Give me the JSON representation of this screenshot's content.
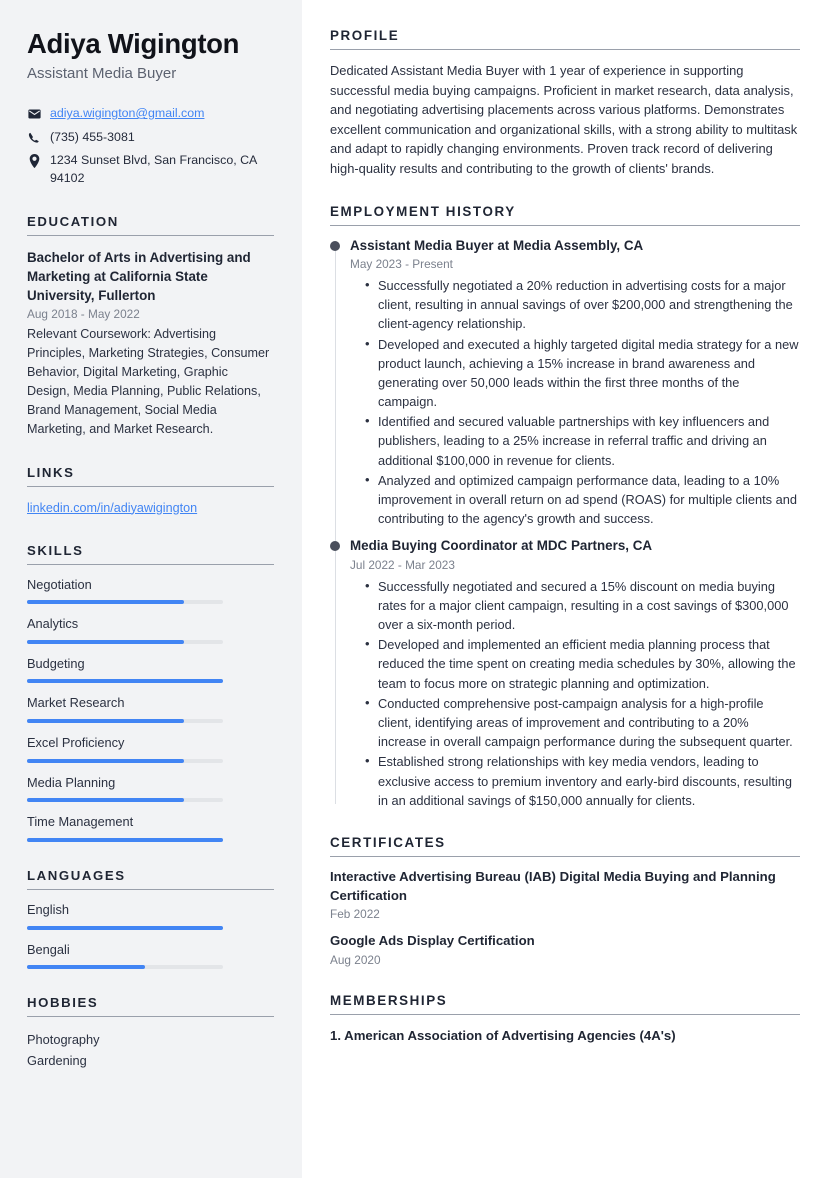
{
  "accent_color": "#4285f4",
  "sidebar_bg": "#f2f3f5",
  "heading_color": "#1f2533",
  "header": {
    "name": "Adiya Wigington",
    "job_title": "Assistant Media Buyer"
  },
  "contact": [
    {
      "icon": "envelope-icon",
      "text": "adiya.wigington@gmail.com",
      "is_link": true
    },
    {
      "icon": "phone-icon",
      "text": "(735) 455-3081",
      "is_link": false
    },
    {
      "icon": "location-pin-icon",
      "text": "1234 Sunset Blvd, San Francisco, CA 94102",
      "is_link": false
    }
  ],
  "education": {
    "heading": "EDUCATION",
    "items": [
      {
        "degree": "Bachelor of Arts in Advertising and Marketing at California State University, Fullerton",
        "date": "Aug 2018 - May 2022",
        "description": "Relevant Coursework: Advertising Principles, Marketing Strategies, Consumer Behavior, Digital Marketing, Graphic Design, Media Planning, Public Relations, Brand Management, Social Media Marketing, and Market Research."
      }
    ]
  },
  "links": {
    "heading": "LINKS",
    "items": [
      {
        "label": "linkedin.com/in/adiyawigington"
      }
    ]
  },
  "skills": {
    "heading": "SKILLS",
    "items": [
      {
        "label": "Negotiation",
        "level": 80
      },
      {
        "label": "Analytics",
        "level": 80
      },
      {
        "label": "Budgeting",
        "level": 100
      },
      {
        "label": "Market Research",
        "level": 80
      },
      {
        "label": "Excel Proficiency",
        "level": 80
      },
      {
        "label": "Media Planning",
        "level": 80
      },
      {
        "label": "Time Management",
        "level": 100
      }
    ]
  },
  "languages": {
    "heading": "LANGUAGES",
    "items": [
      {
        "label": "English",
        "level": 100
      },
      {
        "label": "Bengali",
        "level": 60
      }
    ]
  },
  "hobbies": {
    "heading": "HOBBIES",
    "items": [
      {
        "label": "Photography"
      },
      {
        "label": "Gardening"
      }
    ]
  },
  "profile": {
    "heading": "PROFILE",
    "text": "Dedicated Assistant Media Buyer with 1 year of experience in supporting successful media buying campaigns. Proficient in market research, data analysis, and negotiating advertising placements across various platforms. Demonstrates excellent communication and organizational skills, with a strong ability to multitask and adapt to rapidly changing environments. Proven track record of delivering high-quality results and contributing to the growth of clients' brands."
  },
  "employment": {
    "heading": "EMPLOYMENT HISTORY",
    "jobs": [
      {
        "title": "Assistant Media Buyer at Media Assembly, CA",
        "date": "May 2023 - Present",
        "bullets": [
          "Successfully negotiated a 20% reduction in advertising costs for a major client, resulting in annual savings of over $200,000 and strengthening the client-agency relationship.",
          "Developed and executed a highly targeted digital media strategy for a new product launch, achieving a 15% increase in brand awareness and generating over 50,000 leads within the first three months of the campaign.",
          "Identified and secured valuable partnerships with key influencers and publishers, leading to a 25% increase in referral traffic and driving an additional $100,000 in revenue for clients.",
          "Analyzed and optimized campaign performance data, leading to a 10% improvement in overall return on ad spend (ROAS) for multiple clients and contributing to the agency's growth and success."
        ]
      },
      {
        "title": "Media Buying Coordinator at MDC Partners, CA",
        "date": "Jul 2022 - Mar 2023",
        "bullets": [
          "Successfully negotiated and secured a 15% discount on media buying rates for a major client campaign, resulting in a cost savings of $300,000 over a six-month period.",
          "Developed and implemented an efficient media planning process that reduced the time spent on creating media schedules by 30%, allowing the team to focus more on strategic planning and optimization.",
          "Conducted comprehensive post-campaign analysis for a high-profile client, identifying areas of improvement and contributing to a 20% increase in overall campaign performance during the subsequent quarter.",
          "Established strong relationships with key media vendors, leading to exclusive access to premium inventory and early-bird discounts, resulting in an additional savings of $150,000 annually for clients."
        ]
      }
    ]
  },
  "certificates": {
    "heading": "CERTIFICATES",
    "items": [
      {
        "name": "Interactive Advertising Bureau (IAB) Digital Media Buying and Planning Certification",
        "date": "Feb 2022"
      },
      {
        "name": "Google Ads Display Certification",
        "date": "Aug 2020"
      }
    ]
  },
  "memberships": {
    "heading": "MEMBERSHIPS",
    "items": [
      {
        "label": "1. American Association of Advertising Agencies (4A's)"
      }
    ]
  }
}
